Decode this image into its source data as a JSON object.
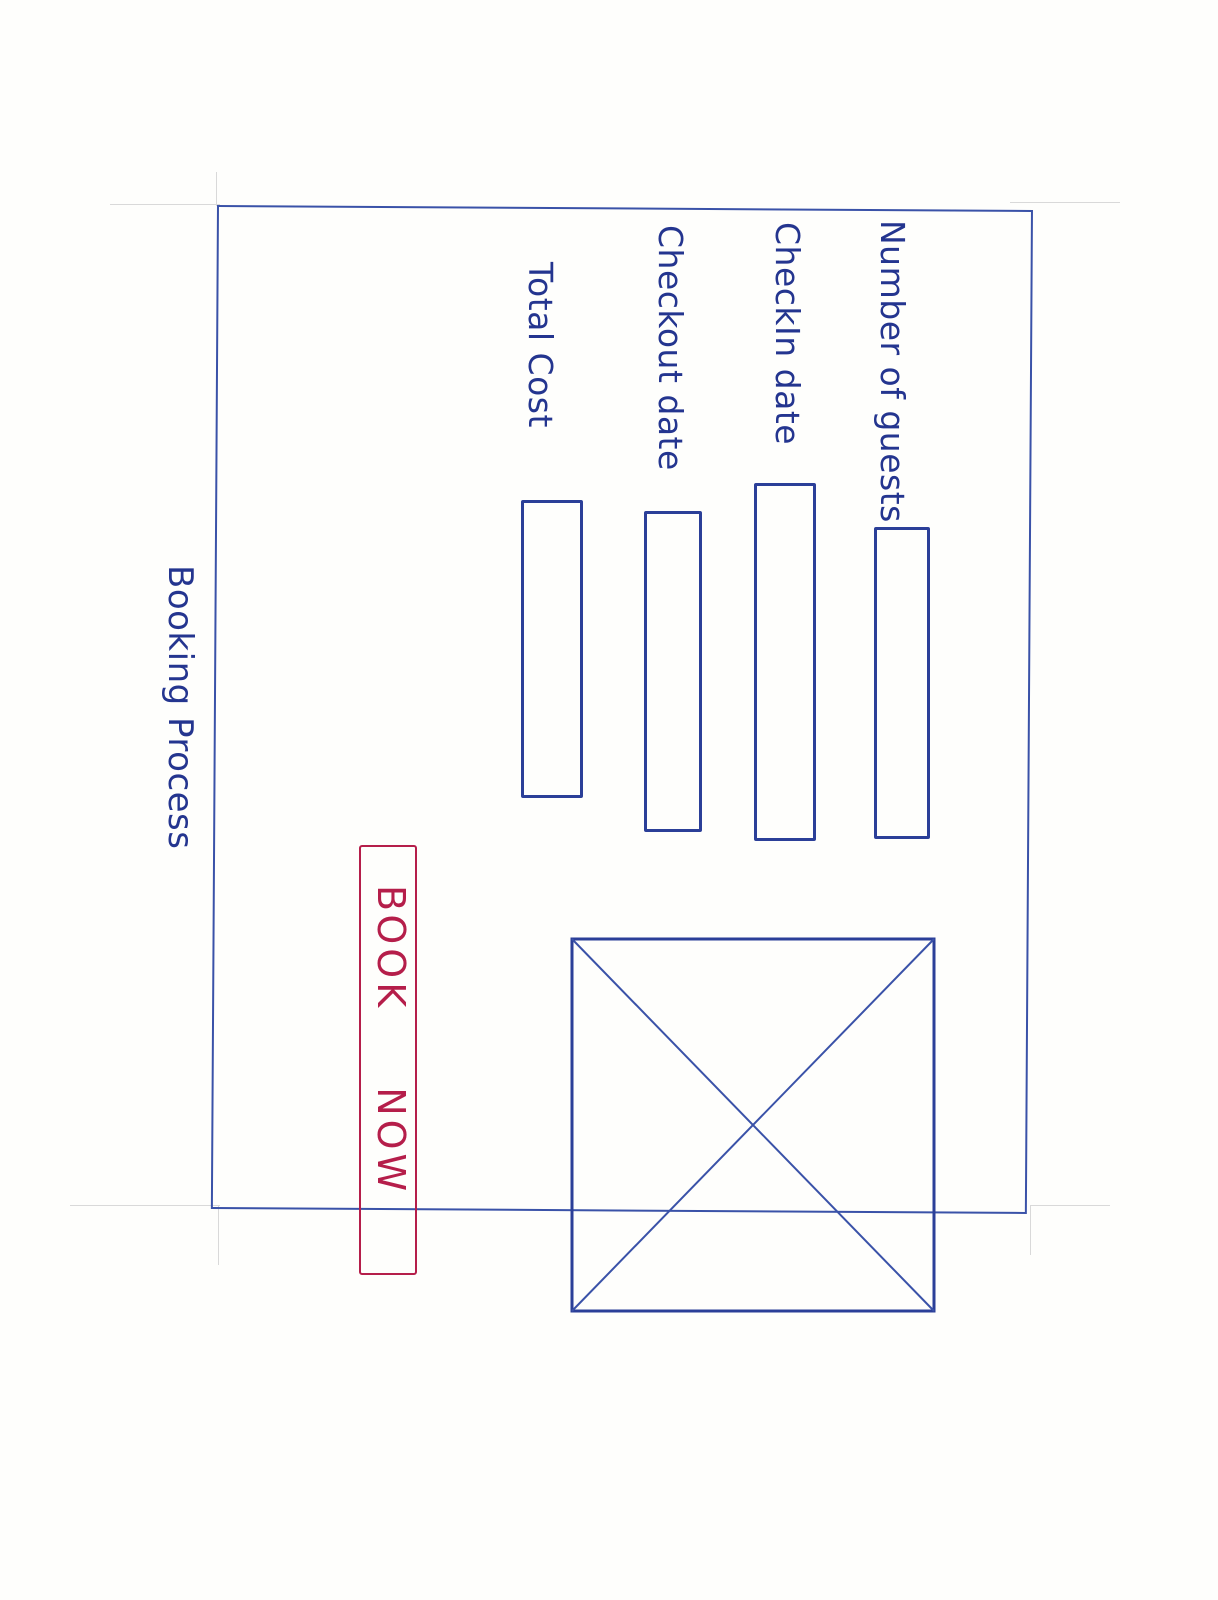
{
  "page": {
    "title": "Booking Process"
  },
  "form": {
    "fields": [
      {
        "label": "Number of guests",
        "value": ""
      },
      {
        "label": "CheckIn date",
        "value": ""
      },
      {
        "label": "Checkout date",
        "value": ""
      },
      {
        "label": "Total Cost",
        "value": ""
      }
    ]
  },
  "actions": {
    "book_label": "BOOK NOW"
  },
  "image": {
    "placeholder_icon": "image-placeholder-icon"
  },
  "colors": {
    "ink_blue": "#2b3f98",
    "ink_red": "#b51e4a",
    "paper": "#fefefc"
  }
}
